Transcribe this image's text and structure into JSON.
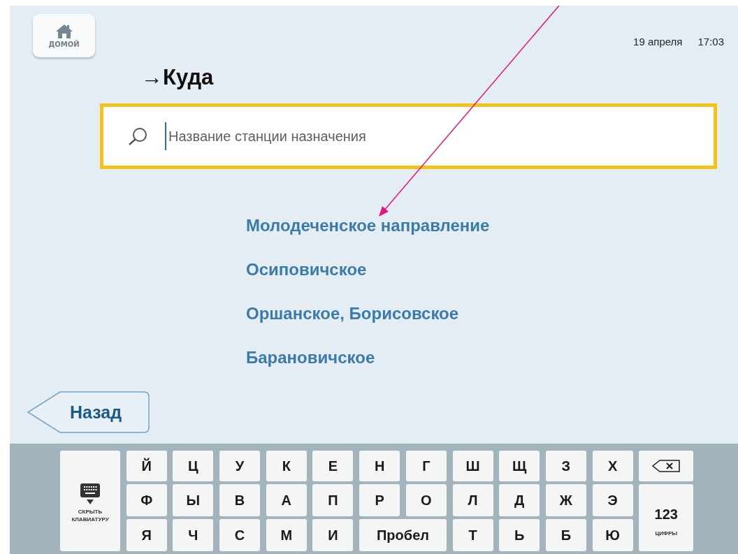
{
  "home_button": {
    "label": "ДОМОЙ"
  },
  "header": {
    "date": "19 апреля",
    "time": "17:03"
  },
  "title": "→Куда",
  "search": {
    "placeholder": "Название станции назначения"
  },
  "directions": [
    {
      "label": "Молодеченское направление"
    },
    {
      "label": "Осиповичское"
    },
    {
      "label": "Оршанское, Борисовское"
    },
    {
      "label": "Барановичское"
    }
  ],
  "back_button": {
    "label": "Назад"
  },
  "keyboard": {
    "hide_key": {
      "label": "СКРЫТЬ КЛАВИАТУРУ"
    },
    "rows": [
      [
        {
          "kind": "letter",
          "label": "Й"
        },
        {
          "kind": "letter",
          "label": "Ц"
        },
        {
          "kind": "letter",
          "label": "У"
        },
        {
          "kind": "letter",
          "label": "К"
        },
        {
          "kind": "letter",
          "label": "Е"
        },
        {
          "kind": "letter",
          "label": "Н"
        },
        {
          "kind": "letter",
          "label": "Г"
        },
        {
          "kind": "letter",
          "label": "Ш"
        },
        {
          "kind": "letter",
          "label": "Щ"
        },
        {
          "kind": "letter",
          "label": "З"
        },
        {
          "kind": "letter",
          "label": "Х"
        },
        {
          "kind": "backspace"
        }
      ],
      [
        {
          "kind": "letter",
          "label": "Ф"
        },
        {
          "kind": "letter",
          "label": "Ы"
        },
        {
          "kind": "letter",
          "label": "В"
        },
        {
          "kind": "letter",
          "label": "А"
        },
        {
          "kind": "letter",
          "label": "П"
        },
        {
          "kind": "letter",
          "label": "Р"
        },
        {
          "kind": "letter",
          "label": "О"
        },
        {
          "kind": "letter",
          "label": "Л"
        },
        {
          "kind": "letter",
          "label": "Д"
        },
        {
          "kind": "letter",
          "label": "Ж"
        },
        {
          "kind": "letter",
          "label": "Э"
        },
        {
          "kind": "numbers",
          "label": "123",
          "caption": "ЦИФРЫ",
          "rowspan": 2
        }
      ],
      [
        {
          "kind": "letter",
          "label": "Я"
        },
        {
          "kind": "letter",
          "label": "Ч"
        },
        {
          "kind": "letter",
          "label": "С"
        },
        {
          "kind": "letter",
          "label": "М"
        },
        {
          "kind": "letter",
          "label": "И"
        },
        {
          "kind": "space",
          "label": "Пробел",
          "colspan": 2
        },
        {
          "kind": "letter",
          "label": "Т"
        },
        {
          "kind": "letter",
          "label": "Ь"
        },
        {
          "kind": "letter",
          "label": "Б"
        },
        {
          "kind": "letter",
          "label": "Ю"
        }
      ]
    ]
  }
}
